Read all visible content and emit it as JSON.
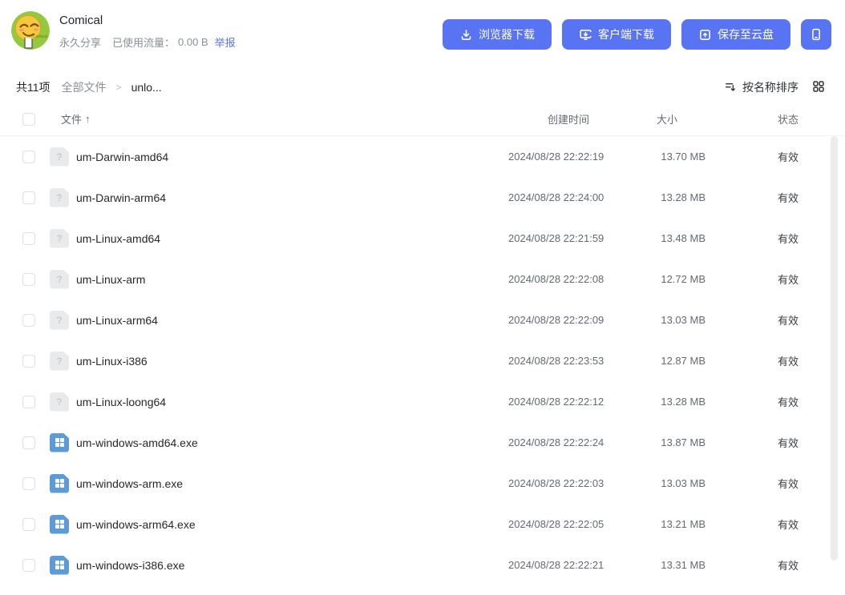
{
  "colors": {
    "accent": "#5874F2",
    "windows_icon_bg": "#5C9BD8",
    "unknown_icon_bg": "#E9EAEC",
    "link": "#5874F2"
  },
  "header": {
    "title": "Comical",
    "share_type": "永久分享",
    "traffic_label": "已使用流量：",
    "traffic_value": "0.00 B",
    "report_link": "举报",
    "buttons": {
      "browser_download": "浏览器下载",
      "client_download": "客户端下载",
      "save_to_cloud": "保存至云盘"
    }
  },
  "toolbar": {
    "total_count": "共11项",
    "breadcrumb_root": "全部文件",
    "breadcrumb_separator": ">",
    "breadcrumb_current": "unlo...",
    "sort_label": "按名称排序"
  },
  "table": {
    "header": {
      "file": "文件",
      "sort_indicator": "↑",
      "created": "创建时间",
      "size": "大小",
      "status": "状态"
    },
    "rows": [
      {
        "name": "um-Darwin-amd64",
        "type": "unknown",
        "created": "2024/08/28 22:22:19",
        "size": "13.70 MB",
        "status": "有效"
      },
      {
        "name": "um-Darwin-arm64",
        "type": "unknown",
        "created": "2024/08/28 22:24:00",
        "size": "13.28 MB",
        "status": "有效"
      },
      {
        "name": "um-Linux-amd64",
        "type": "unknown",
        "created": "2024/08/28 22:21:59",
        "size": "13.48 MB",
        "status": "有效"
      },
      {
        "name": "um-Linux-arm",
        "type": "unknown",
        "created": "2024/08/28 22:22:08",
        "size": "12.72 MB",
        "status": "有效"
      },
      {
        "name": "um-Linux-arm64",
        "type": "unknown",
        "created": "2024/08/28 22:22:09",
        "size": "13.03 MB",
        "status": "有效"
      },
      {
        "name": "um-Linux-i386",
        "type": "unknown",
        "created": "2024/08/28 22:23:53",
        "size": "12.87 MB",
        "status": "有效"
      },
      {
        "name": "um-Linux-loong64",
        "type": "unknown",
        "created": "2024/08/28 22:22:12",
        "size": "13.28 MB",
        "status": "有效"
      },
      {
        "name": "um-windows-amd64.exe",
        "type": "windows",
        "created": "2024/08/28 22:22:24",
        "size": "13.87 MB",
        "status": "有效"
      },
      {
        "name": "um-windows-arm.exe",
        "type": "windows",
        "created": "2024/08/28 22:22:03",
        "size": "13.03 MB",
        "status": "有效"
      },
      {
        "name": "um-windows-arm64.exe",
        "type": "windows",
        "created": "2024/08/28 22:22:05",
        "size": "13.21 MB",
        "status": "有效"
      },
      {
        "name": "um-windows-i386.exe",
        "type": "windows",
        "created": "2024/08/28 22:22:21",
        "size": "13.31 MB",
        "status": "有效"
      }
    ]
  }
}
